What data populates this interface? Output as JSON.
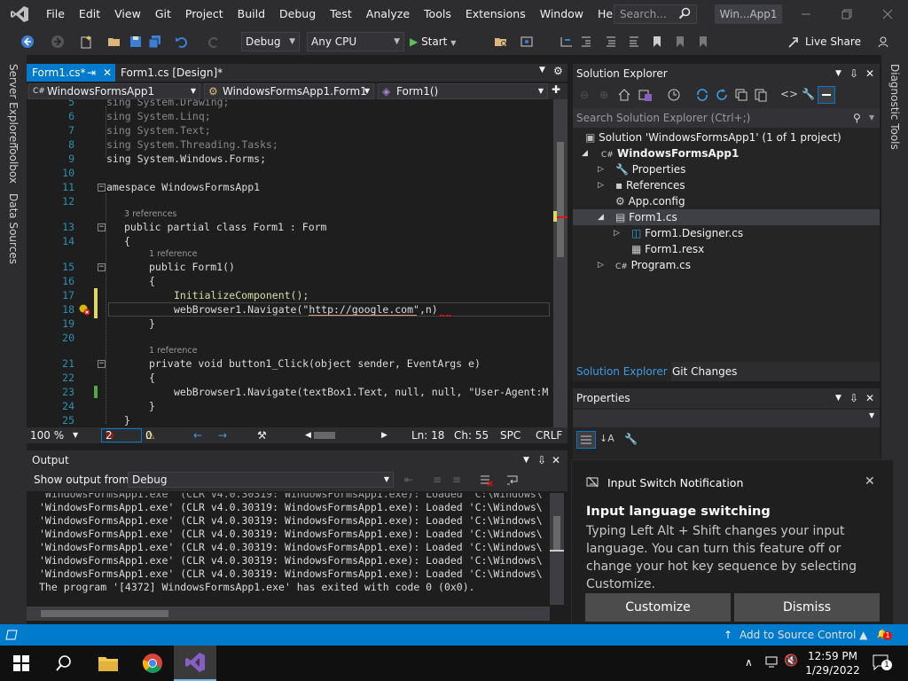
{
  "menu": [
    "File",
    "Edit",
    "View",
    "Git",
    "Project",
    "Build",
    "Debug",
    "Test",
    "Analyze",
    "Tools",
    "Extensions",
    "Window",
    "Help"
  ],
  "search_placeholder": "Search...",
  "window_title": "Win...App1",
  "toolbar": {
    "config": "Debug",
    "platform": "Any CPU",
    "start": "Start",
    "liveshare": "Live Share"
  },
  "left_tabs": [
    "Server Explorer",
    "Toolbox",
    "Data Sources"
  ],
  "right_tabs": [
    "Diagnostic Tools"
  ],
  "editor": {
    "tab_active": "Form1.cs*",
    "tab_design": "Form1.cs [Design]*",
    "nav_project": "WindowsFormsApp1",
    "nav_class": "WindowsFormsApp1.Form1",
    "nav_member": "Form1()",
    "ref3": "3 references",
    "ref1a": "1 reference",
    "ref1b": "1 reference",
    "lines": [
      {
        "n": "5",
        "t": "sing System.Drawing;"
      },
      {
        "n": "6",
        "t": "sing System.Linq;"
      },
      {
        "n": "7",
        "t": "sing System.Text;"
      },
      {
        "n": "8",
        "t": "sing System.Threading.Tasks;"
      },
      {
        "n": "9",
        "t": "sing System.Windows.Forms;"
      },
      {
        "n": "10",
        "t": ""
      },
      {
        "n": "11",
        "t": "amespace WindowsFormsApp1"
      },
      {
        "n": "12",
        "t": ""
      },
      {
        "n": "13",
        "t": "public partial class Form1 : Form"
      },
      {
        "n": "14",
        "t": "{"
      },
      {
        "n": "15",
        "t": "public Form1()"
      },
      {
        "n": "16",
        "t": "{"
      },
      {
        "n": "17",
        "t": "InitializeComponent();"
      },
      {
        "n": "18",
        "t": "webBrowser1.Navigate(\"http://google.com\",n)"
      },
      {
        "n": "19",
        "t": "}"
      },
      {
        "n": "20",
        "t": ""
      },
      {
        "n": "21",
        "t": "private void button1_Click(object sender, EventArgs e)"
      },
      {
        "n": "22",
        "t": "{"
      },
      {
        "n": "23",
        "t": "webBrowser1.Navigate(textBox1.Text, null, null, \"User-Agent:M"
      },
      {
        "n": "24",
        "t": "}"
      },
      {
        "n": "25",
        "t": "}"
      }
    ],
    "status": {
      "zoom": "100 %",
      "errors": "2",
      "warnings": "0",
      "ln": "Ln: 18",
      "ch": "Ch: 55",
      "spc": "SPC",
      "crlf": "CRLF"
    }
  },
  "output": {
    "title": "Output",
    "show_from_label": "Show output from:",
    "show_from_value": "Debug",
    "lines": [
      "'WindowsFormsApp1.exe' (CLR v4.0.30319: WindowsFormsApp1.exe): Loaded 'C:\\Windows\\",
      "'WindowsFormsApp1.exe' (CLR v4.0.30319: WindowsFormsApp1.exe): Loaded 'C:\\Windows\\",
      "'WindowsFormsApp1.exe' (CLR v4.0.30319: WindowsFormsApp1.exe): Loaded 'C:\\Windows\\",
      "'WindowsFormsApp1.exe' (CLR v4.0.30319: WindowsFormsApp1.exe): Loaded 'C:\\Windows\\",
      "'WindowsFormsApp1.exe' (CLR v4.0.30319: WindowsFormsApp1.exe): Loaded 'C:\\Windows\\",
      "'WindowsFormsApp1.exe' (CLR v4.0.30319: WindowsFormsApp1.exe): Loaded 'C:\\Windows\\",
      "'WindowsFormsApp1.exe' (CLR v4.0.30319: WindowsFormsApp1.exe): Loaded 'C:\\Windows\\",
      "The program '[4372] WindowsFormsApp1.exe' has exited with code 0 (0x0)."
    ]
  },
  "solution_explorer": {
    "title": "Solution Explorer",
    "search_placeholder": "Search Solution Explorer (Ctrl+;)",
    "solution": "Solution 'WindowsFormsApp1' (1 of 1 project)",
    "project": "WindowsFormsApp1",
    "properties": "Properties",
    "references": "References",
    "appconfig": "App.config",
    "form1": "Form1.cs",
    "designer": "Form1.Designer.cs",
    "resx": "Form1.resx",
    "program": "Program.cs",
    "tab1": "Solution Explorer",
    "tab2": "Git Changes"
  },
  "properties_panel": {
    "title": "Properties"
  },
  "notification": {
    "title": "Input Switch Notification",
    "heading": "Input language switching",
    "body": "Typing Left Alt + Shift changes your input language. You can turn this feature off or change your hot key sequence by selecting Customize.",
    "customize": "Customize",
    "dismiss": "Dismiss"
  },
  "statusbar": {
    "source_control": "Add to Source Control",
    "badge": "1"
  },
  "taskbar": {
    "time": "12:59 PM",
    "date": "1/29/2022",
    "notif_count": "1"
  },
  "colors": {
    "accent": "#007acc",
    "bg": "#1e1e1e",
    "chrome": "#2d2d30",
    "vs_purple": "#865fc5"
  }
}
